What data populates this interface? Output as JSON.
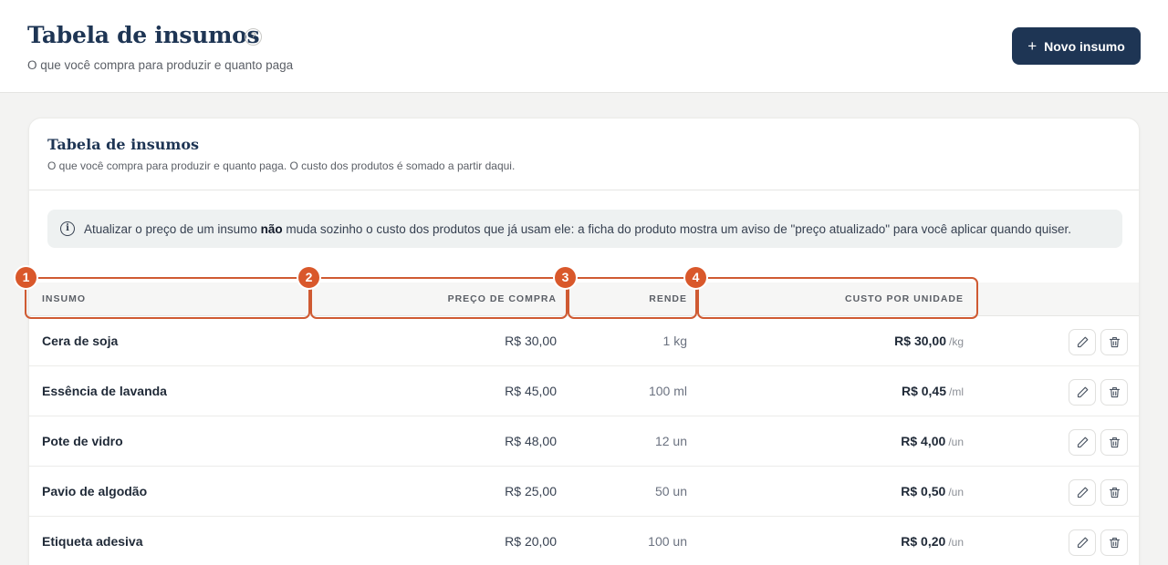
{
  "header": {
    "title": "Tabela de insumos",
    "help_icon": "?",
    "subtitle": "O que você compra para produzir e quanto paga",
    "new_button": {
      "icon": "+",
      "label": "Novo insumo"
    }
  },
  "card": {
    "title": "Tabela de insumos",
    "subtitle": "O que você compra para produzir e quanto paga. O custo dos produtos é somado a partir daqui.",
    "info": {
      "icon": "i",
      "text_before": "Atualizar o preço de um insumo ",
      "text_bold": "não",
      "text_after": " muda sozinho o custo dos produtos que já usam ele: a ficha do produto mostra um aviso de \"preço atualizado\" para você aplicar quando quiser."
    }
  },
  "table": {
    "columns": {
      "name": "INSUMO",
      "price": "PREÇO DE COMPRA",
      "yield": "RENDE",
      "cost": "CUSTO POR UNIDADE"
    },
    "rows": [
      {
        "name": "Cera de soja",
        "price": "R$ 30,00",
        "yield": "1 kg",
        "cost": "R$ 30,00",
        "unit": "/kg"
      },
      {
        "name": "Essência de lavanda",
        "price": "R$ 45,00",
        "yield": "100 ml",
        "cost": "R$ 0,45",
        "unit": "/ml"
      },
      {
        "name": "Pote de vidro",
        "price": "R$ 48,00",
        "yield": "12 un",
        "cost": "R$ 4,00",
        "unit": "/un"
      },
      {
        "name": "Pavio de algodão",
        "price": "R$ 25,00",
        "yield": "50 un",
        "cost": "R$ 0,50",
        "unit": "/un"
      },
      {
        "name": "Etiqueta adesiva",
        "price": "R$ 20,00",
        "yield": "100 un",
        "cost": "R$ 0,20",
        "unit": "/un"
      }
    ]
  },
  "annotations": [
    "1",
    "2",
    "3",
    "4"
  ],
  "colors": {
    "primary": "#1e3554",
    "annotation": "#d9582b"
  }
}
